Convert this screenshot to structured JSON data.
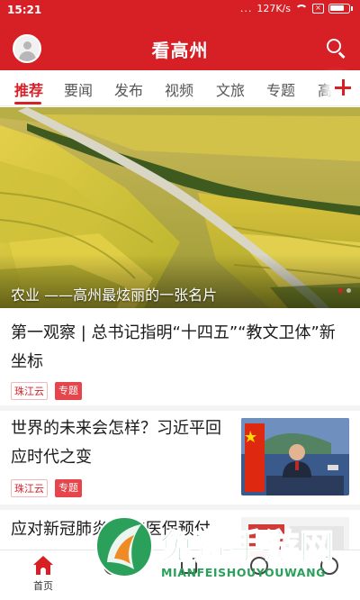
{
  "status": {
    "time": "15:21",
    "dots": "...",
    "speed": "127K/s"
  },
  "header": {
    "title": "看高州"
  },
  "tabs": [
    {
      "label": "推荐",
      "active": true
    },
    {
      "label": "要闻"
    },
    {
      "label": "发布"
    },
    {
      "label": "视频"
    },
    {
      "label": "文旅"
    },
    {
      "label": "专题"
    },
    {
      "label": "高"
    }
  ],
  "banner": {
    "caption": "农业 ——高州最炫丽的一张名片"
  },
  "feed": [
    {
      "title_line1": "第一观察 | 总书记指明“十四五”“教文卫体”新",
      "title_line2": "坐标",
      "source": "珠江云",
      "tag": "专题"
    },
    {
      "title_line1": "世界的未来会怎样？习近平回",
      "title_line2": "应时代之变",
      "source": "珠江云",
      "tag": "专题"
    },
    {
      "title_line1": "应对新冠肺炎 广东医保预付"
    }
  ],
  "bottom_nav": {
    "home_label": "首页"
  },
  "watermark": {
    "cn": "免费手游网",
    "en": "MIANFEISHOUYOUWANG"
  },
  "colors": {
    "brand_red": "#d71f26",
    "watermark_green": "#2aa05a"
  }
}
